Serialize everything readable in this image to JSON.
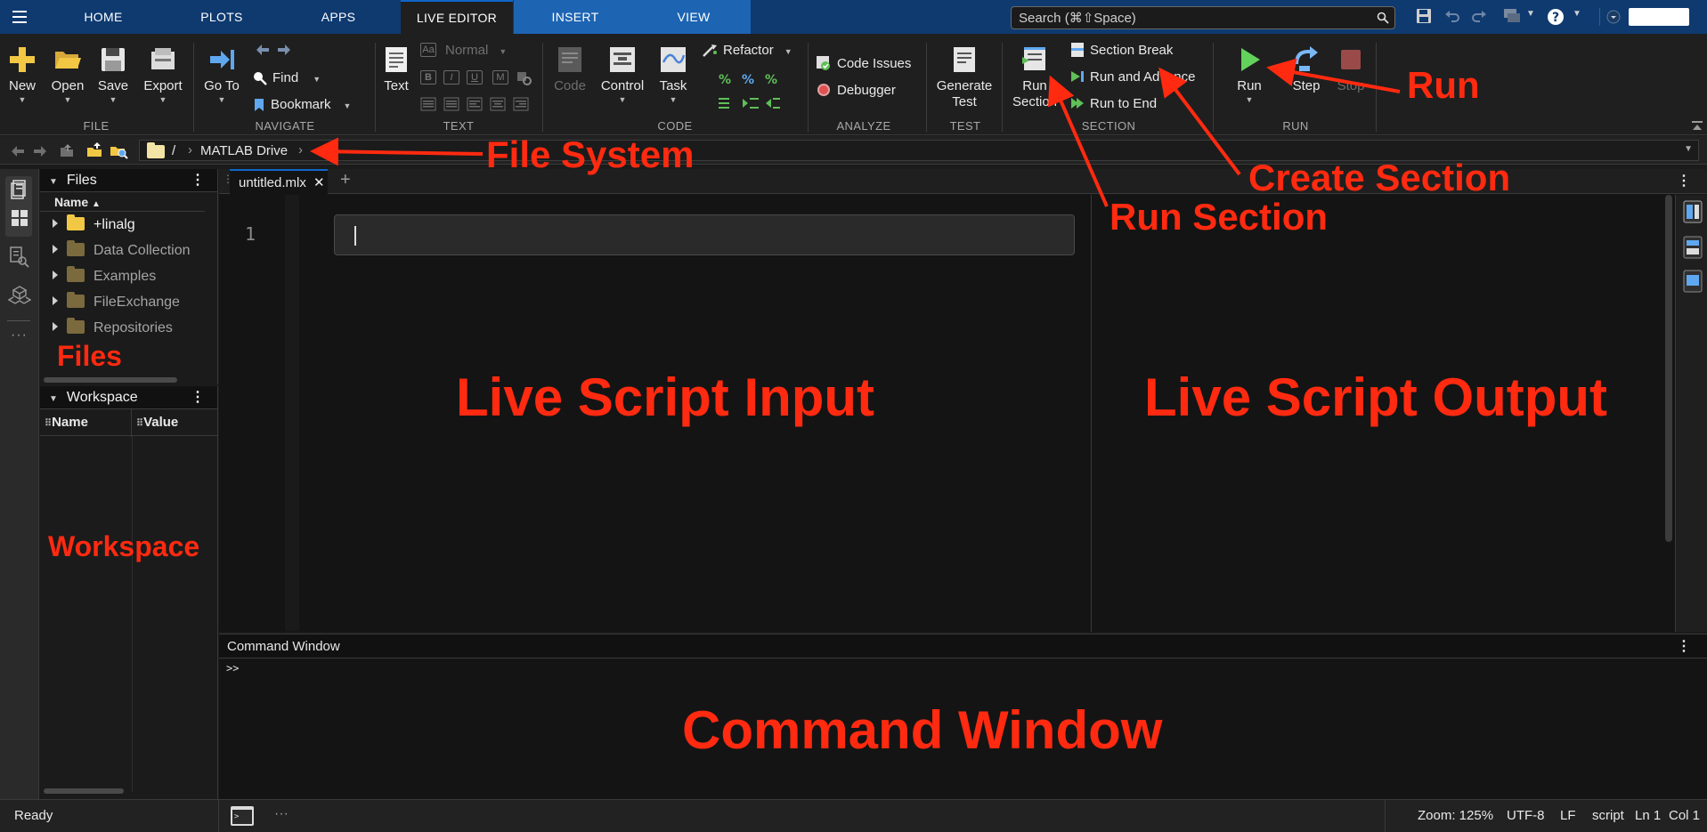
{
  "tabs": [
    {
      "label": "HOME",
      "state": "normal"
    },
    {
      "label": "PLOTS",
      "state": "normal"
    },
    {
      "label": "APPS",
      "state": "normal"
    },
    {
      "label": "LIVE EDITOR",
      "state": "active"
    },
    {
      "label": "INSERT",
      "state": "highlight"
    },
    {
      "label": "VIEW",
      "state": "highlight"
    }
  ],
  "search": {
    "placeholder": "Search (⌘⇧Space)"
  },
  "ribbon": {
    "file": {
      "group": "FILE",
      "new": "New",
      "open": "Open",
      "save": "Save",
      "export": "Export"
    },
    "navigate": {
      "group": "NAVIGATE",
      "goto": "Go To",
      "find": "Find",
      "bookmark": "Bookmark"
    },
    "text": {
      "group": "TEXT",
      "text": "Text",
      "style": "Normal"
    },
    "code": {
      "group": "CODE",
      "code": "Code",
      "control": "Control",
      "task": "Task",
      "refactor": "Refactor"
    },
    "analyze": {
      "group": "ANALYZE",
      "code_issues": "Code Issues",
      "debugger": "Debugger"
    },
    "test": {
      "group": "TEST",
      "generate1": "Generate",
      "generate2": "Test"
    },
    "section": {
      "group": "SECTION",
      "run_section1": "Run",
      "run_section2": "Section",
      "section_break": "Section Break",
      "run_and_advance": "Run and Advance",
      "run_to_end": "Run to End"
    },
    "run": {
      "group": "RUN",
      "run": "Run",
      "step": "Step",
      "stop": "Stop"
    }
  },
  "address": {
    "root": "/",
    "separator": "›",
    "folder": "MATLAB Drive"
  },
  "files": {
    "title": "Files",
    "column": "Name",
    "items": [
      {
        "name": "+linalg",
        "bright": true
      },
      {
        "name": "Data Collection",
        "bright": false
      },
      {
        "name": "Examples",
        "bright": false
      },
      {
        "name": "FileExchange",
        "bright": false
      },
      {
        "name": "Repositories",
        "bright": false
      }
    ]
  },
  "workspace": {
    "title": "Workspace",
    "col_name": "Name",
    "col_value": "Value"
  },
  "editor": {
    "tab": "untitled.mlx",
    "line_number": "1",
    "add_tab": "+"
  },
  "command_window": {
    "title": "Command Window",
    "prompt": ">>"
  },
  "status": {
    "ready": "Ready",
    "zoom": "Zoom: 125%",
    "encoding": "UTF-8",
    "eol": "LF",
    "type": "script",
    "ln": "Ln 1",
    "col": "Col 1"
  },
  "annotations": {
    "run": "Run",
    "file_system": "File System",
    "create_section": "Create Section",
    "run_section": "Run Section",
    "files": "Files",
    "input": "Live Script Input",
    "output": "Live Script Output",
    "workspace": "Workspace",
    "command_window": "Command Window"
  },
  "colors": {
    "annotation": "#ff2a10",
    "accent": "#0f67c9",
    "tabbar": "#0e3a70",
    "folder_bright": "#f2c744",
    "folder_dim": "#7a6a3e"
  }
}
